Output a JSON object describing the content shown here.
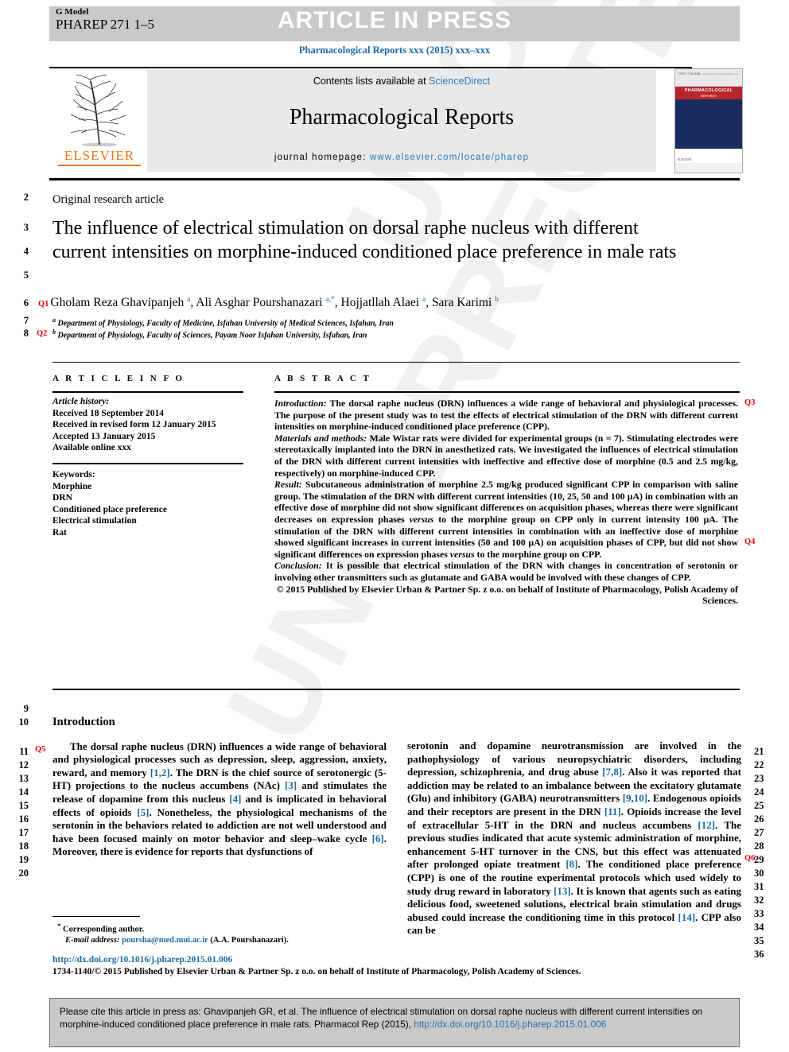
{
  "header": {
    "g_model_label": "G Model",
    "manuscript_id": "PHAREP 271 1–5",
    "status_banner": "ARTICLE IN PRESS",
    "journal_running_head": "Pharmacological Reports xxx (2015) xxx–xxx"
  },
  "masthead": {
    "contents_prefix": "Contents lists available at ",
    "sciencedirect": "ScienceDirect",
    "journal_title": "Pharmacological Reports",
    "homepage_label": "journal homepage: ",
    "homepage_url": "www.elsevier.com/locate/pharep",
    "publisher_wordmark": "ELSEVIER",
    "cover_journal_name": "PHARMACOLOGICAL",
    "cover_journal_name2": "REPORTS",
    "cover_top_left": "ISSN 1734-1140",
    "cover_top_right": "Available online at www.sciencedirect.com",
    "cover_footer": "ELSEVIER"
  },
  "article": {
    "type": "Original research article",
    "title": "The influence of electrical stimulation on dorsal raphe nucleus with different current intensities on morphine-induced conditioned place preference in male rats",
    "authors_html": "Gholam Reza Ghavipanjeh <sup class=\"aff\">a</sup>, Ali Asghar Pourshanazari <sup class=\"aff\">a,*</sup>, Hojjatllah Alaei <sup class=\"aff\">a</sup>, Sara Karimi <sup class=\"aff\">b</sup>",
    "affiliation_a": "Department of Physiology, Faculty of Medicine, Isfahan University of Medical Sciences, Isfahan, Iran",
    "affiliation_b": "Department of Physiology, Faculty of Sciences, Payam Noor Isfahan University, Isfahan, Iran"
  },
  "queries": {
    "q1": "Q1",
    "q2": "Q2",
    "q3": "Q3",
    "q4": "Q4",
    "q5": "Q5",
    "q6": "Q6"
  },
  "article_info": {
    "heading": "A R T I C L E   I N F O",
    "history_label": "Article history:",
    "history": [
      "Received 18 September 2014",
      "Received in revised form 12 January 2015",
      "Accepted 13 January 2015",
      "Available online xxx"
    ],
    "keywords_label": "Keywords:",
    "keywords": [
      "Morphine",
      "DRN",
      "Conditioned place preference",
      "Electrical stimulation",
      "Rat"
    ]
  },
  "abstract": {
    "heading": "A B S T R A C T",
    "introduction_label": "Introduction:",
    "introduction_text": " The dorsal raphe nucleus (DRN) influences a wide range of behavioral and physiological processes. The purpose of the present study was to test the effects of electrical stimulation of the DRN with different current intensities on morphine-induced conditioned place preference (CPP).",
    "methods_label": "Materials and methods:",
    "methods_text": " Male Wistar rats were divided for experimental groups (n = 7). Stimulating electrodes were stereotaxically implanted into the DRN in anesthetized rats. We investigated the influences of electrical stimulation of the DRN with different current intensities with ineffective and effective dose of morphine (0.5 and 2.5 mg/kg, respectively) on morphine-induced CPP.",
    "result_label": "Result:",
    "result_text_1": " Subcutaneous administration of morphine 2.5 mg/kg produced significant CPP in comparison with saline group. The stimulation of the DRN with different current intensities (10, 25, 50 and 100 μA) in combination with an effective dose of morphine did not show significant differences on acquisition phases, whereas there were significant decreases on expression phases ",
    "result_versus_1": "versus",
    "result_text_2": " to the morphine group on CPP only in current intensity 100 μA. The stimulation of the DRN with different current intensities in combination with an ineffective dose of morphine showed significant increases in current intensities (50 and 100 μA) on acquisition phases of CPP, but did not show significant differences on expression phases ",
    "result_versus_2": "versus",
    "result_text_3": " to the morphine group on CPP.",
    "conclusion_label": "Conclusion:",
    "conclusion_text": " It is possible that electrical stimulation of the DRN with changes in concentration of serotonin or involving other transmitters such as glutamate and GABA would be involved with these changes of CPP.",
    "copyright": "© 2015 Published by Elsevier Urban & Partner Sp. z o.o. on behalf of Institute of Pharmacology, Polish Academy of Sciences."
  },
  "body": {
    "intro_heading": "Introduction",
    "left_paragraph_parts": [
      "The dorsal raphe nucleus (DRN) influences a wide range of behavioral and physiological processes such as depression, sleep, aggression, anxiety, reward, and memory ",
      "[1,2]",
      ". The DRN is the chief source of serotonergic (5-HT) projections to the nucleus accumbens (NAc) ",
      "[3]",
      " and stimulates the release of dopamine from this nucleus ",
      "[4]",
      " and is implicated in behavioral effects of opioids ",
      "[5]",
      ". Nonetheless, the physiological mechanisms of the serotonin in the behaviors related to addiction are not well understood and have been focused mainly on motor behavior and sleep–wake cycle ",
      "[6]",
      ". Moreover, there is evidence for reports that dysfunctions of"
    ],
    "right_paragraph_parts": [
      "serotonin and dopamine neurotransmission are involved in the pathophysiology of various neuropsychiatric disorders, including depression, schizophrenia, and drug abuse ",
      "[7,8]",
      ". Also it was reported that addiction may be related to an imbalance between the excitatory glutamate (Glu) and inhibitory (GABA) neurotransmitters ",
      "[9,10]",
      ". Endogenous opioids and their receptors are present in the DRN ",
      "[11]",
      ". Opioids increase the level of extracellular 5-HT in the DRN and nucleus accumbens ",
      "[12]",
      ". The previous studies indicated that acute systemic administration of morphine, enhancement 5-HT turnover in the CNS, but this effect was attenuated after prolonged opiate treatment ",
      "[8]",
      ". The conditioned place preference (CPP) is one of the routine experimental protocols which used widely to study drug reward in laboratory ",
      "[13]",
      ". It is known that agents such as eating delicious food, sweetened solutions, electrical brain stimulation and drugs abused could increase the conditioning time in this protocol ",
      "[14]",
      ". CPP also can be"
    ]
  },
  "footnote": {
    "corresponding_marker": "*",
    "corresponding_label": " Corresponding author.",
    "email_label": "E-mail address:",
    "email": "poursha@med.mui.ac.ir",
    "email_owner": " (A.A. Pourshanazari)."
  },
  "doi_block": {
    "doi_url": "http://dx.doi.org/10.1016/j.pharep.2015.01.006",
    "issn_line": "1734-1140/© 2015 Published by Elsevier Urban & Partner Sp. z o.o. on behalf of Institute of Pharmacology, Polish Academy of Sciences."
  },
  "cite_box": {
    "text_before_link": "Please cite this article in press as: Ghavipanjeh GR, et al. The influence of electrical stimulation on dorsal raphe nucleus with different current intensities on morphine-induced conditioned place preference in male rats. Pharmacol Rep (2015), ",
    "link": "http://dx.doi.org/10.1016/j.pharep.2015.01.006"
  },
  "line_numbers": {
    "left": [
      "2",
      "3",
      "4",
      "5",
      "6",
      "7",
      "8",
      "9",
      "10",
      "11",
      "12",
      "13",
      "14",
      "15",
      "16",
      "17",
      "18",
      "19",
      "20"
    ],
    "right": [
      "21",
      "22",
      "23",
      "24",
      "25",
      "26",
      "27",
      "28",
      "29",
      "30",
      "31",
      "32",
      "33",
      "34",
      "35",
      "36"
    ]
  },
  "watermark": {
    "text": "UNCORRECTED PROOF"
  },
  "colors": {
    "link_blue": "#1a6aa6",
    "query_red": "#e8000d",
    "band_gray": "#c9c9c9",
    "elsevier_orange": "#e8761b"
  }
}
